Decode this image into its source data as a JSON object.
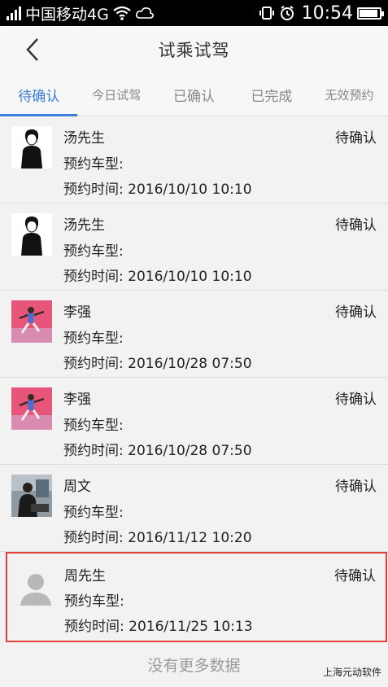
{
  "status_bar": {
    "carrier": "中国移动4G",
    "time": "10:54",
    "battery_level": 0.9,
    "icons": [
      "signal-icon",
      "wifi-icon",
      "cloud-icon",
      "vibrate-icon",
      "alarm-icon",
      "battery-icon"
    ]
  },
  "header": {
    "back_icon": "chevron-left-icon",
    "title": "试乘试驾"
  },
  "tabs": [
    {
      "label": "待确认",
      "active": true
    },
    {
      "label": "今日试驾",
      "active": false
    },
    {
      "label": "已确认",
      "active": false
    },
    {
      "label": "已完成",
      "active": false
    },
    {
      "label": "无效预约",
      "active": false
    }
  ],
  "labels": {
    "car_model": "预约车型:",
    "time_prefix": "预约时间:"
  },
  "appointments": [
    {
      "name": "汤先生",
      "status": "待确认",
      "car_model": "",
      "time": "2016/10/10 10:10",
      "avatar": "silhouette"
    },
    {
      "name": "汤先生",
      "status": "待确认",
      "car_model": "",
      "time": "2016/10/10 10:10",
      "avatar": "silhouette"
    },
    {
      "name": "李强",
      "status": "待确认",
      "car_model": "",
      "time": "2016/10/28 07:50",
      "avatar": "photo-pink"
    },
    {
      "name": "李强",
      "status": "待确认",
      "car_model": "",
      "time": "2016/10/28 07:50",
      "avatar": "photo-pink"
    },
    {
      "name": "周文",
      "status": "待确认",
      "car_model": "",
      "time": "2016/11/12 10:20",
      "avatar": "photo-office"
    },
    {
      "name": "周先生",
      "status": "待确认",
      "car_model": "",
      "time": "2016/11/25 10:13",
      "avatar": "default",
      "highlighted": true
    }
  ],
  "footer": {
    "no_more": "没有更多数据"
  },
  "watermark": "上海元动软件",
  "colors": {
    "accent": "#3b7bd9",
    "highlight_border": "#e0413a"
  }
}
